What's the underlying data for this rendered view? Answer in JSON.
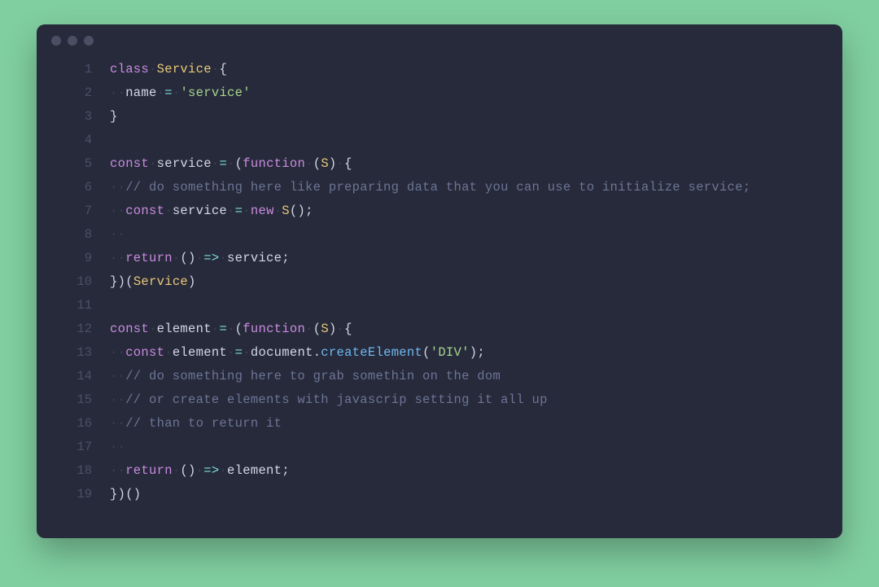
{
  "code": {
    "lines": [
      {
        "n": "1",
        "tokens": [
          {
            "t": "class",
            "c": "kw"
          },
          {
            "t": "·",
            "c": "ws"
          },
          {
            "t": "Service",
            "c": "cls"
          },
          {
            "t": "·",
            "c": "ws"
          },
          {
            "t": "{",
            "c": "pn"
          }
        ]
      },
      {
        "n": "2",
        "tokens": [
          {
            "t": "··",
            "c": "ws"
          },
          {
            "t": "name",
            "c": "id"
          },
          {
            "t": "·",
            "c": "ws"
          },
          {
            "t": "=",
            "c": "op"
          },
          {
            "t": "·",
            "c": "ws"
          },
          {
            "t": "'service'",
            "c": "str"
          }
        ]
      },
      {
        "n": "3",
        "tokens": [
          {
            "t": "}",
            "c": "pn"
          }
        ]
      },
      {
        "n": "4",
        "tokens": []
      },
      {
        "n": "5",
        "tokens": [
          {
            "t": "const",
            "c": "kw"
          },
          {
            "t": "·",
            "c": "ws"
          },
          {
            "t": "service",
            "c": "id"
          },
          {
            "t": "·",
            "c": "ws"
          },
          {
            "t": "=",
            "c": "op"
          },
          {
            "t": "·",
            "c": "ws"
          },
          {
            "t": "(",
            "c": "pn"
          },
          {
            "t": "function",
            "c": "kw"
          },
          {
            "t": "·",
            "c": "ws"
          },
          {
            "t": "(",
            "c": "pn"
          },
          {
            "t": "S",
            "c": "cls"
          },
          {
            "t": ")",
            "c": "pn"
          },
          {
            "t": "·",
            "c": "ws"
          },
          {
            "t": "{",
            "c": "pn"
          }
        ]
      },
      {
        "n": "6",
        "tokens": [
          {
            "t": "··",
            "c": "ws"
          },
          {
            "t": "// do something here like preparing data that you can use to initialize service;",
            "c": "cm"
          }
        ]
      },
      {
        "n": "7",
        "tokens": [
          {
            "t": "··",
            "c": "ws"
          },
          {
            "t": "const",
            "c": "kw"
          },
          {
            "t": "·",
            "c": "ws"
          },
          {
            "t": "service",
            "c": "id"
          },
          {
            "t": "·",
            "c": "ws"
          },
          {
            "t": "=",
            "c": "op"
          },
          {
            "t": "·",
            "c": "ws"
          },
          {
            "t": "new",
            "c": "kw"
          },
          {
            "t": "·",
            "c": "ws"
          },
          {
            "t": "S",
            "c": "cls"
          },
          {
            "t": "();",
            "c": "pn"
          }
        ]
      },
      {
        "n": "8",
        "tokens": [
          {
            "t": "··",
            "c": "ws"
          }
        ]
      },
      {
        "n": "9",
        "tokens": [
          {
            "t": "··",
            "c": "ws"
          },
          {
            "t": "return",
            "c": "kw"
          },
          {
            "t": "·",
            "c": "ws"
          },
          {
            "t": "()",
            "c": "pn"
          },
          {
            "t": "·",
            "c": "ws"
          },
          {
            "t": "=>",
            "c": "op"
          },
          {
            "t": "·",
            "c": "ws"
          },
          {
            "t": "service;",
            "c": "id"
          }
        ]
      },
      {
        "n": "10",
        "tokens": [
          {
            "t": "})(",
            "c": "pn"
          },
          {
            "t": "Service",
            "c": "cls"
          },
          {
            "t": ")",
            "c": "pn"
          }
        ]
      },
      {
        "n": "11",
        "tokens": []
      },
      {
        "n": "12",
        "tokens": [
          {
            "t": "const",
            "c": "kw"
          },
          {
            "t": "·",
            "c": "ws"
          },
          {
            "t": "element",
            "c": "id"
          },
          {
            "t": "·",
            "c": "ws"
          },
          {
            "t": "=",
            "c": "op"
          },
          {
            "t": "·",
            "c": "ws"
          },
          {
            "t": "(",
            "c": "pn"
          },
          {
            "t": "function",
            "c": "kw"
          },
          {
            "t": "·",
            "c": "ws"
          },
          {
            "t": "(",
            "c": "pn"
          },
          {
            "t": "S",
            "c": "cls"
          },
          {
            "t": ")",
            "c": "pn"
          },
          {
            "t": "·",
            "c": "ws"
          },
          {
            "t": "{",
            "c": "pn"
          }
        ]
      },
      {
        "n": "13",
        "tokens": [
          {
            "t": "··",
            "c": "ws"
          },
          {
            "t": "const",
            "c": "kw"
          },
          {
            "t": "·",
            "c": "ws"
          },
          {
            "t": "element",
            "c": "id"
          },
          {
            "t": "·",
            "c": "ws"
          },
          {
            "t": "=",
            "c": "op"
          },
          {
            "t": "·",
            "c": "ws"
          },
          {
            "t": "document",
            "c": "id"
          },
          {
            "t": ".",
            "c": "pn"
          },
          {
            "t": "createElement",
            "c": "fn"
          },
          {
            "t": "(",
            "c": "pn"
          },
          {
            "t": "'DIV'",
            "c": "str"
          },
          {
            "t": ");",
            "c": "pn"
          }
        ]
      },
      {
        "n": "14",
        "tokens": [
          {
            "t": "··",
            "c": "ws"
          },
          {
            "t": "// do something here to grab somethin on the dom",
            "c": "cm"
          }
        ]
      },
      {
        "n": "15",
        "tokens": [
          {
            "t": "··",
            "c": "ws"
          },
          {
            "t": "// or create elements with javascrip setting it all up",
            "c": "cm"
          }
        ]
      },
      {
        "n": "16",
        "tokens": [
          {
            "t": "··",
            "c": "ws"
          },
          {
            "t": "// than to return it",
            "c": "cm"
          }
        ]
      },
      {
        "n": "17",
        "tokens": [
          {
            "t": "··",
            "c": "ws"
          }
        ]
      },
      {
        "n": "18",
        "tokens": [
          {
            "t": "··",
            "c": "ws"
          },
          {
            "t": "return",
            "c": "kw"
          },
          {
            "t": "·",
            "c": "ws"
          },
          {
            "t": "()",
            "c": "pn"
          },
          {
            "t": "·",
            "c": "ws"
          },
          {
            "t": "=>",
            "c": "op"
          },
          {
            "t": "·",
            "c": "ws"
          },
          {
            "t": "element;",
            "c": "id"
          }
        ]
      },
      {
        "n": "19",
        "tokens": [
          {
            "t": "})()",
            "c": "pn"
          }
        ]
      }
    ]
  }
}
